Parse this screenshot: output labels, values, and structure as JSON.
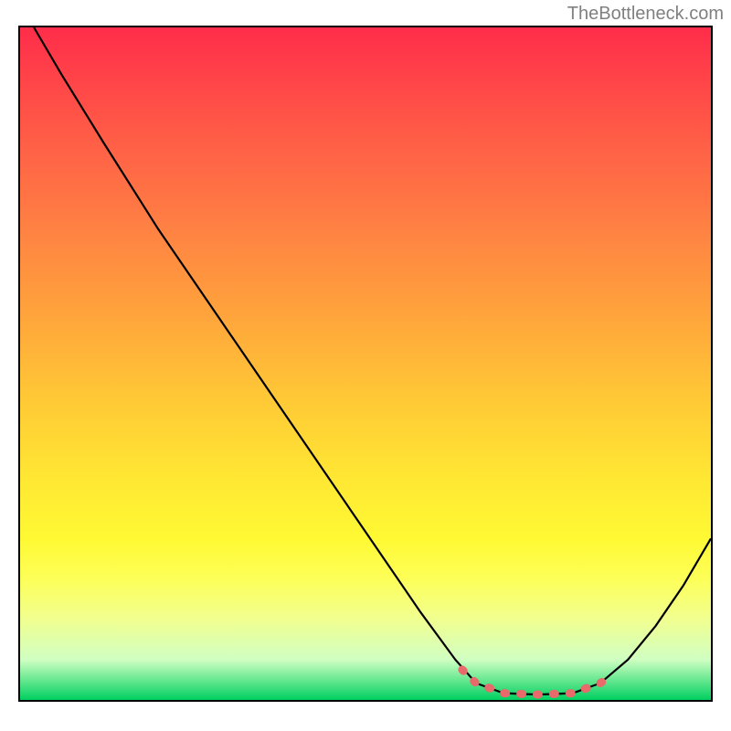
{
  "watermark": "TheBottleneck.com",
  "chart_data": {
    "type": "line",
    "title": "",
    "xlabel": "",
    "ylabel": "",
    "xlim": [
      0,
      100
    ],
    "ylim": [
      0,
      100
    ],
    "series": [
      {
        "name": "curve",
        "style": "black-line",
        "points": [
          {
            "x": 2,
            "y": 100
          },
          {
            "x": 6,
            "y": 93
          },
          {
            "x": 12,
            "y": 83
          },
          {
            "x": 20,
            "y": 70
          },
          {
            "x": 30,
            "y": 55
          },
          {
            "x": 40,
            "y": 40
          },
          {
            "x": 50,
            "y": 25
          },
          {
            "x": 58,
            "y": 13
          },
          {
            "x": 63,
            "y": 6
          },
          {
            "x": 66,
            "y": 2.5
          },
          {
            "x": 70,
            "y": 1
          },
          {
            "x": 75,
            "y": 0.8
          },
          {
            "x": 80,
            "y": 1
          },
          {
            "x": 84,
            "y": 2.5
          },
          {
            "x": 88,
            "y": 6
          },
          {
            "x": 92,
            "y": 11
          },
          {
            "x": 96,
            "y": 17
          },
          {
            "x": 100,
            "y": 24
          }
        ]
      },
      {
        "name": "highlight-segment",
        "style": "red-thick-dotted",
        "points": [
          {
            "x": 64,
            "y": 4.5
          },
          {
            "x": 66,
            "y": 2.5
          },
          {
            "x": 70,
            "y": 1
          },
          {
            "x": 75,
            "y": 0.8
          },
          {
            "x": 80,
            "y": 1
          },
          {
            "x": 84,
            "y": 2.5
          },
          {
            "x": 85.5,
            "y": 3.5
          }
        ]
      }
    ],
    "gradient_stops": [
      {
        "pos": 0,
        "color": "#ff2d4a"
      },
      {
        "pos": 14,
        "color": "#ff5647"
      },
      {
        "pos": 28,
        "color": "#ff7c44"
      },
      {
        "pos": 42,
        "color": "#ffa23c"
      },
      {
        "pos": 55,
        "color": "#ffc836"
      },
      {
        "pos": 67,
        "color": "#ffe733"
      },
      {
        "pos": 76,
        "color": "#fff933"
      },
      {
        "pos": 82,
        "color": "#fdff58"
      },
      {
        "pos": 88,
        "color": "#f1ff90"
      },
      {
        "pos": 94,
        "color": "#d0ffc2"
      },
      {
        "pos": 100,
        "color": "#00d060"
      }
    ]
  }
}
